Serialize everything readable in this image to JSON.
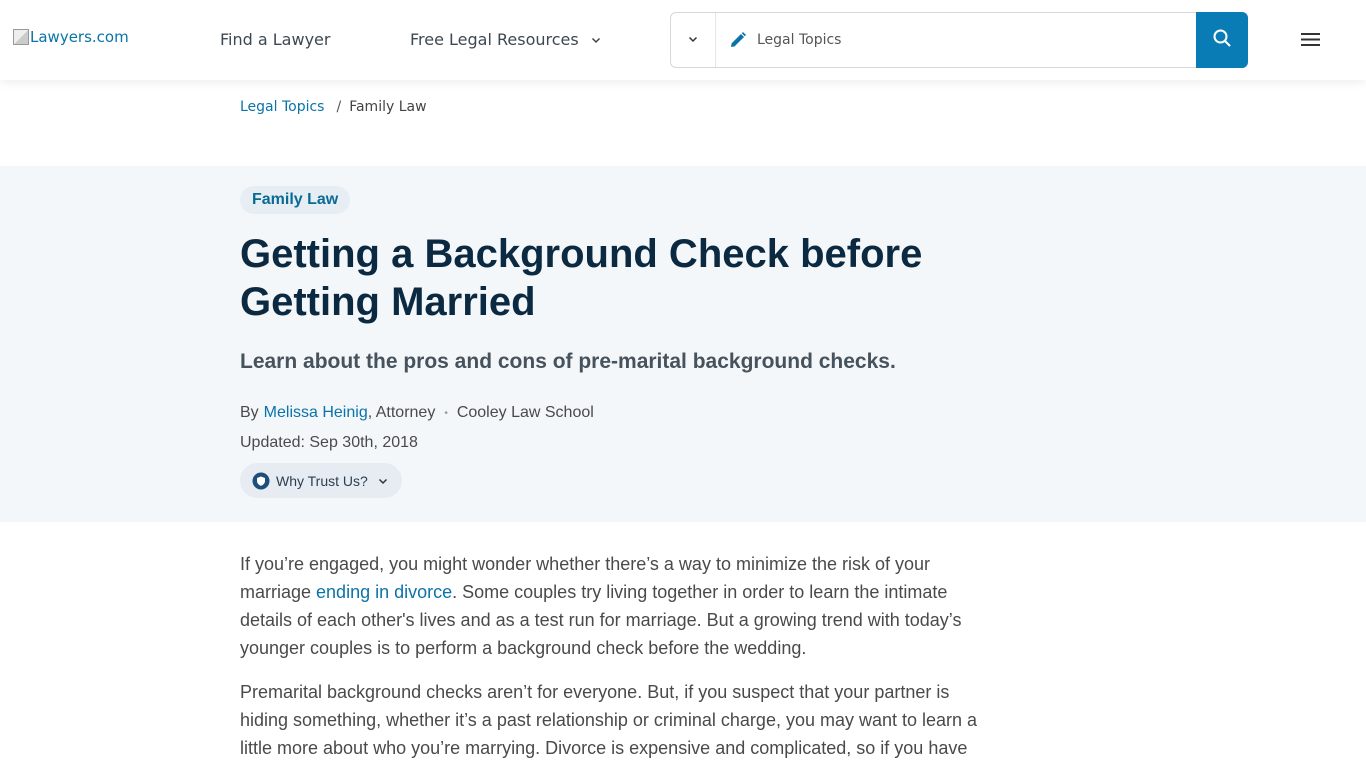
{
  "header": {
    "logo_alt": "Lawyers.com",
    "nav": {
      "find_lawyer": "Find a Lawyer",
      "free_resources": "Free Legal Resources"
    },
    "search": {
      "placeholder": "Legal Topics"
    }
  },
  "breadcrumb": {
    "parent": "Legal Topics",
    "separator": "/",
    "current": "Family Law"
  },
  "hero": {
    "category": "Family Law",
    "title": "Getting a Background Check before Getting Married",
    "subtitle": "Learn about the pros and cons of pre-marital background checks.",
    "byline": {
      "by": "By",
      "author": "Melissa Heinig",
      "role": ", Attorney",
      "dot": "•",
      "school": "Cooley Law School"
    },
    "updated": "Updated: Sep 30th, 2018",
    "trust_label": "Why Trust Us?"
  },
  "article": {
    "p1_before": "If you’re engaged, you might wonder whether there’s a way to minimize the risk of your marriage ",
    "p1_link": "ending in divorce",
    "p1_after": ". Some couples try living together in order to learn the intimate details of each other's lives and as a test run for marriage. But a growing trend with today’s younger couples is to perform a background check before the wedding.",
    "p2": "Premarital background checks aren’t for everyone. But, if you suspect that your partner is hiding something, whether it’s a past relationship or criminal charge, you may want to learn a little more about who you’re marrying. Divorce is expensive and complicated, so if you have"
  },
  "colors": {
    "brand_blue": "#0a7cb5",
    "link": "#0a73a8",
    "title": "#0b2a42",
    "hero_bg": "#f4f7fa"
  }
}
